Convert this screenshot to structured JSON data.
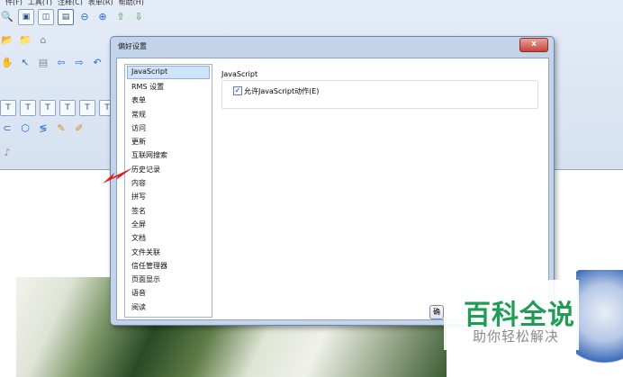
{
  "menu": {
    "items": [
      "件(F)",
      "工具(T)",
      "注释(C)",
      "表单(R)",
      "帮助(H)"
    ]
  },
  "toolbar": {
    "rows": [
      [
        {
          "name": "zoom-icon",
          "glyph": "🔍",
          "cls": "blue"
        },
        {
          "name": "fit-page-icon",
          "glyph": "▣",
          "cls": "box"
        },
        {
          "name": "fit-width-icon",
          "glyph": "◫",
          "cls": "box"
        },
        {
          "name": "actual-size-icon",
          "glyph": "▤",
          "cls": "box on"
        },
        {
          "name": "zoom-out-icon",
          "glyph": "⊖",
          "cls": "blue"
        },
        {
          "name": "zoom-in-icon",
          "glyph": "⊕",
          "cls": "blue"
        },
        {
          "name": "page-up-icon",
          "glyph": "⇧",
          "cls": "green"
        },
        {
          "name": "page-down-icon",
          "glyph": "⇩",
          "cls": "green"
        }
      ],
      [
        {
          "name": "open-folder-icon",
          "glyph": "📂",
          "cls": "orange"
        },
        {
          "name": "save-folder-icon",
          "glyph": "📁",
          "cls": "orange"
        },
        {
          "name": "home-icon",
          "glyph": "⌂",
          "cls": "gray"
        }
      ],
      [
        {
          "name": "hand-tool-icon",
          "glyph": "✋",
          "cls": "orange"
        },
        {
          "name": "select-tool-icon",
          "glyph": "↖",
          "cls": "blue"
        },
        {
          "name": "text-select-icon",
          "glyph": "▤",
          "cls": "gray"
        },
        {
          "name": "back-icon",
          "glyph": "⇦",
          "cls": "blue"
        },
        {
          "name": "forward-icon",
          "glyph": "⇨",
          "cls": "blue"
        },
        {
          "name": "undo-icon",
          "glyph": "↶",
          "cls": "blue"
        }
      ],
      [
        {
          "name": "text-tool-icon",
          "glyph": "T",
          "cls": "box"
        },
        {
          "name": "text-box-icon",
          "glyph": "T",
          "cls": "box"
        },
        {
          "name": "strikeout-icon",
          "glyph": "T",
          "cls": "box"
        },
        {
          "name": "underline-icon",
          "glyph": "T",
          "cls": "box"
        },
        {
          "name": "insert-text-icon",
          "glyph": "T",
          "cls": "box"
        },
        {
          "name": "replace-text-icon",
          "glyph": "T",
          "cls": "box"
        }
      ],
      [
        {
          "name": "polygon-line-icon",
          "glyph": "⊂",
          "cls": "blue"
        },
        {
          "name": "polygon-icon",
          "glyph": "⬡",
          "cls": "blue"
        },
        {
          "name": "squiggly-icon",
          "glyph": "≶",
          "cls": "blue"
        },
        {
          "name": "pencil-icon",
          "glyph": "✎",
          "cls": "orange"
        },
        {
          "name": "eraser-icon",
          "glyph": "✐",
          "cls": "orange"
        }
      ],
      [
        {
          "name": "sound-icon",
          "glyph": "♪",
          "cls": "gray"
        }
      ]
    ]
  },
  "dialog": {
    "title": "偏好设置",
    "close_label": "x",
    "categories": [
      "JavaScript",
      "RMS 设置",
      "表单",
      "常规",
      "访问",
      "更新",
      "互联网搜索",
      "历史记录",
      "内容",
      "拼写",
      "签名",
      "全屏",
      "文档",
      "文件关联",
      "信任管理器",
      "页面显示",
      "语音",
      "阅读"
    ],
    "selected_index": 0,
    "pane_title": "JavaScript",
    "enable_js_label": "允许JavaScript动作(E)",
    "enable_js_checked": true,
    "ok_label": "确"
  },
  "watermark": {
    "main": "百科全说",
    "sub": "助你轻松解决"
  }
}
